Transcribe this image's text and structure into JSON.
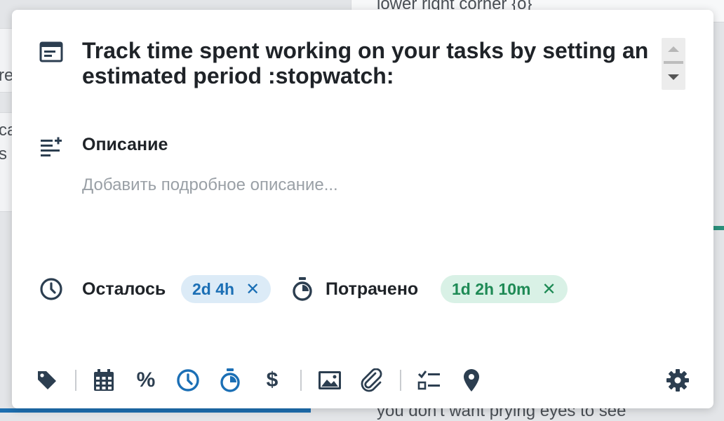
{
  "background": {
    "top_text": "lower right corner {o}",
    "frag_a": "re",
    "frag_b": "ca",
    "frag_c": "s",
    "bottom_text": "you don't want prying eyes to see"
  },
  "task": {
    "title": "Track time spent working on your tasks by setting an estimated period :stopwatch:"
  },
  "description": {
    "label": "Описание",
    "placeholder": "Добавить подробное описание..."
  },
  "time": {
    "remaining_label": "Осталось",
    "remaining_value": "2d 4h",
    "spent_label": "Потрачено",
    "spent_value": "1d 2h 10m",
    "remove_glyph": "✕"
  },
  "toolbar": {
    "percent_symbol": "%",
    "dollar_symbol": "$"
  },
  "colors": {
    "accent_blue": "#1b6fb5",
    "accent_green": "#1e8a55",
    "icon_dark": "#2c3e50"
  }
}
